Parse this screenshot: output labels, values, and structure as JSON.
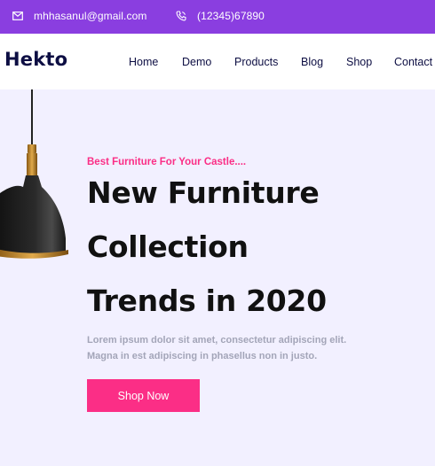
{
  "topbar": {
    "email": "mhhasanul@gmail.com",
    "phone": "(12345)67890",
    "background": "#8a3ee0"
  },
  "navbar": {
    "logo": "Hekto",
    "links": [
      "Home",
      "Demo",
      "Products",
      "Blog",
      "Shop",
      "Contact"
    ]
  },
  "hero": {
    "kicker": "Best Furniture For Your Castle....",
    "headline_lines": [
      "New Furniture",
      "Collection",
      "Trends in 2020"
    ],
    "description_lines": [
      "Lorem ipsum dolor sit amet, consectetur adipiscing elit.",
      "Magna in est adipiscing in phasellus non in justo."
    ],
    "cta_label": "Shop Now",
    "accent": "#fb2e86",
    "background": "#f2f0ff"
  },
  "icons": {
    "email": "mail-icon",
    "phone": "phone-icon",
    "lamp": "pendant-lamp-image"
  }
}
